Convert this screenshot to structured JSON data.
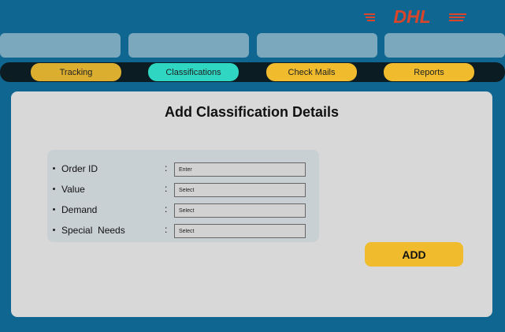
{
  "brand": {
    "logo_text": "DHL",
    "logo_color": "#d9452a"
  },
  "colors": {
    "background": "#0f6690",
    "nav_bar": "#0b1c22",
    "tab_default": "#f0bc2e",
    "tab_active": "#2fd6c2",
    "panel": "#d8d8d8",
    "form_box": "#c8d0d4"
  },
  "nav": {
    "tabs": [
      {
        "label": "Tracking",
        "active": false
      },
      {
        "label": "Classifications",
        "active": true
      },
      {
        "label": "Check Mails",
        "active": false
      },
      {
        "label": "Reports",
        "active": false
      }
    ]
  },
  "form": {
    "title": "Add Classification Details",
    "fields": [
      {
        "label": "Order ID",
        "placeholder": "Enter"
      },
      {
        "label": "Value",
        "placeholder": "Select"
      },
      {
        "label": "Demand",
        "placeholder": "Select"
      },
      {
        "label": "Special  Needs",
        "placeholder": "Select"
      }
    ],
    "add_label": "ADD"
  }
}
